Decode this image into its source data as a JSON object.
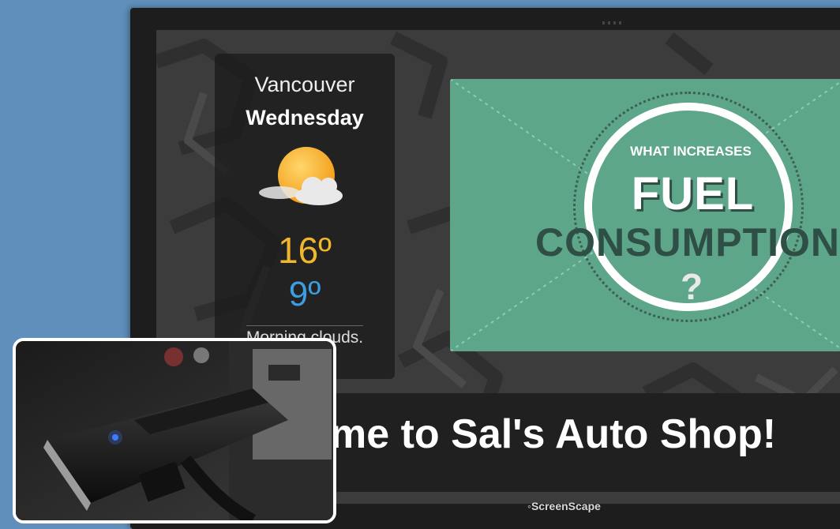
{
  "weather": {
    "city": "Vancouver",
    "day": "Wednesday",
    "high": "16º",
    "low": "9º",
    "condition": "Morning clouds.",
    "icon": "partly-cloudy-sun-icon",
    "high_color": "#f0b62c",
    "low_color": "#3c9ee0"
  },
  "promo": {
    "kicker": "WHAT INCREASES",
    "headline": "FUEL",
    "subhead": "CONSUMPTION",
    "question": "?",
    "background_color": "#5ea68a"
  },
  "ticker": {
    "message": "me to Sal's Auto Shop!"
  },
  "footer": {
    "brand": "ScreenScape"
  },
  "inset_photo": {
    "subject": "compute-stick-device-icon"
  },
  "colors": {
    "wall": "#5f8fba",
    "bezel": "#1d1d1d"
  }
}
